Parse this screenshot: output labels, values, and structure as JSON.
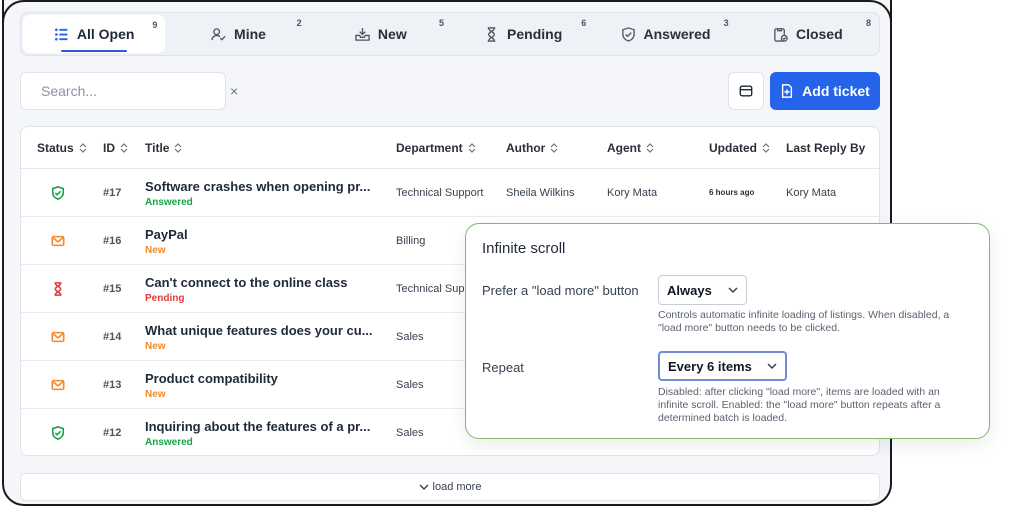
{
  "tabs": [
    {
      "label": "All Open",
      "count": "9",
      "icon": "list-icon",
      "active": true
    },
    {
      "label": "Mine",
      "count": "2",
      "icon": "user-icon"
    },
    {
      "label": "New",
      "count": "5",
      "icon": "inbox-icon"
    },
    {
      "label": "Pending",
      "count": "6",
      "icon": "hourglass-icon"
    },
    {
      "label": "Answered",
      "count": "3",
      "icon": "shield-check-icon"
    },
    {
      "label": "Closed",
      "count": "8",
      "icon": "clipboard-check-icon"
    }
  ],
  "search": {
    "placeholder": "Search...",
    "clear": "×"
  },
  "toolbar": {
    "add_label": "Add ticket"
  },
  "table": {
    "headers": [
      "Status",
      "ID",
      "Title",
      "Department",
      "Author",
      "Agent",
      "Updated",
      "Last Reply By"
    ],
    "rows": [
      {
        "status": "answered",
        "id": "#17",
        "title": "Software crashes when opening pr...",
        "state": "Answered",
        "dept": "Technical Support",
        "author": "Sheila Wilkins",
        "agent": "Kory Mata",
        "updated": "6 hours ago",
        "last_reply": "Kory Mata"
      },
      {
        "status": "new",
        "id": "#16",
        "title": "PayPal",
        "state": "New",
        "dept": "Billing"
      },
      {
        "status": "pending",
        "id": "#15",
        "title": "Can't connect to the online class",
        "state": "Pending",
        "dept": "Technical Supp"
      },
      {
        "status": "new",
        "id": "#14",
        "title": "What unique features does your cu...",
        "state": "New",
        "dept": "Sales"
      },
      {
        "status": "new",
        "id": "#13",
        "title": "Product compatibility",
        "state": "New",
        "dept": "Sales"
      },
      {
        "status": "answered",
        "id": "#12",
        "title": "Inquiring about the features of a pr...",
        "state": "Answered",
        "dept": "Sales"
      }
    ]
  },
  "load_more": "load more",
  "popup": {
    "title": "Infinite scroll",
    "pref_label": "Prefer a \"load more\" button",
    "pref_value": "Always",
    "pref_help": "Controls automatic infinite loading of listings. When disabled, a \"load more\" button needs to be clicked.",
    "repeat_label": "Repeat",
    "repeat_value": "Every 6 items",
    "repeat_help": "Disabled: after clicking \"load more\", items are loaded with an infinite scroll. Enabled: the \"load more\" button repeats after a determined batch is loaded."
  },
  "colors": {
    "primary": "#2563eb",
    "answered": "#16a34a",
    "new": "#f08a24",
    "pending": "#e23b3b",
    "popup_border": "#7cbb6c"
  }
}
